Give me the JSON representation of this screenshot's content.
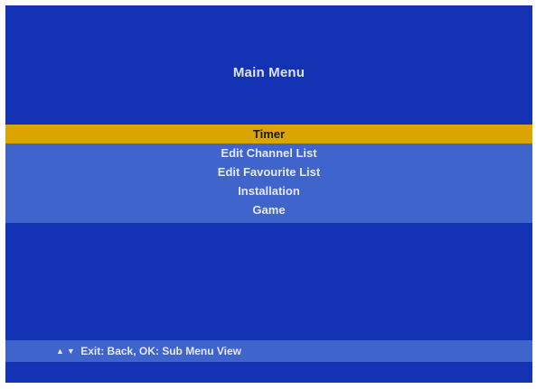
{
  "header": {
    "title": "Main Menu"
  },
  "menu": {
    "items": [
      {
        "label": "Timer"
      },
      {
        "label": "Edit Channel List"
      },
      {
        "label": "Edit Favourite List"
      },
      {
        "label": "Installation"
      },
      {
        "label": "Game"
      }
    ],
    "selected_index": 0
  },
  "footer": {
    "up_icon": "up-arrow-icon",
    "down_icon": "down-arrow-icon",
    "hint_text": "Exit: Back, OK: Sub Menu View"
  },
  "colors": {
    "background": "#1433b4",
    "menu_band": "#3f64cc",
    "highlight": "#dca400"
  }
}
